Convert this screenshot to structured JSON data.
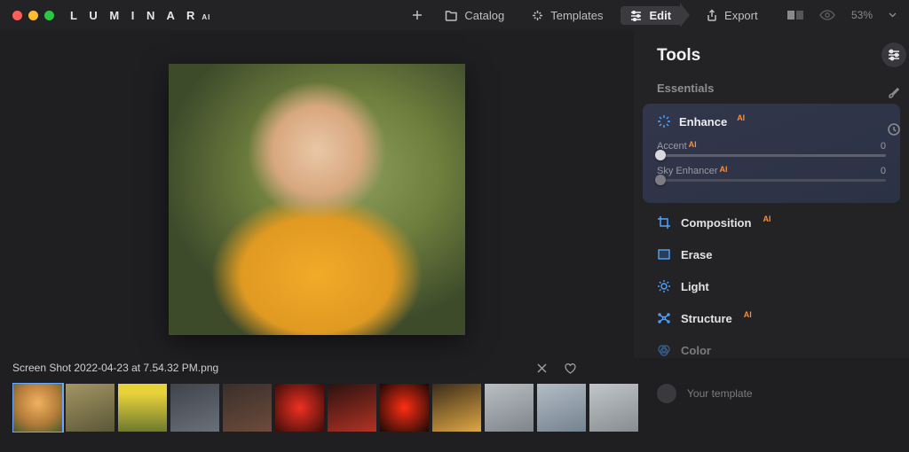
{
  "brand": {
    "name": "L U M I N A R",
    "suffix": "AI"
  },
  "nav": {
    "catalog": "Catalog",
    "templates": "Templates",
    "edit": "Edit",
    "export": "Export"
  },
  "zoom": "53%",
  "tools": {
    "title": "Tools",
    "category": "Essentials",
    "enhance": {
      "label": "Enhance",
      "sliders": {
        "accent": {
          "label": "Accent",
          "value": "0"
        },
        "sky": {
          "label": "Sky Enhancer",
          "value": "0"
        }
      }
    },
    "items": {
      "composition": "Composition",
      "erase": "Erase",
      "light": "Light",
      "structure": "Structure",
      "color": "Color"
    },
    "template_hint": "Your template"
  },
  "bottom": {
    "filename": "Screen Shot 2022-04-23 at 7.54.32 PM.png"
  },
  "thumbs": [
    "radial-gradient(circle at 50% 40%, #f0b25f, #b57d3a 55%, #4a5a2f)",
    "linear-gradient(160deg,#a39664,#5a5637)",
    "linear-gradient(180deg,#e8d23a 20%,#6e7a2e)",
    "linear-gradient(160deg,#3f444b,#6a7079)",
    "linear-gradient(160deg,#3a2f2a,#6d4b3a)",
    "radial-gradient(circle,#f03021,#3a0d0a)",
    "linear-gradient(160deg,#2b120f,#b33224)",
    "radial-gradient(circle,#ff2e12,#1a0806)",
    "linear-gradient(160deg,#3b2c1b,#e0a842)",
    "linear-gradient(160deg,#b9bec2,#7e858b)",
    "linear-gradient(160deg,#b3bcc6,#74828f)",
    "linear-gradient(160deg,#c1c6c9,#868c90)"
  ]
}
